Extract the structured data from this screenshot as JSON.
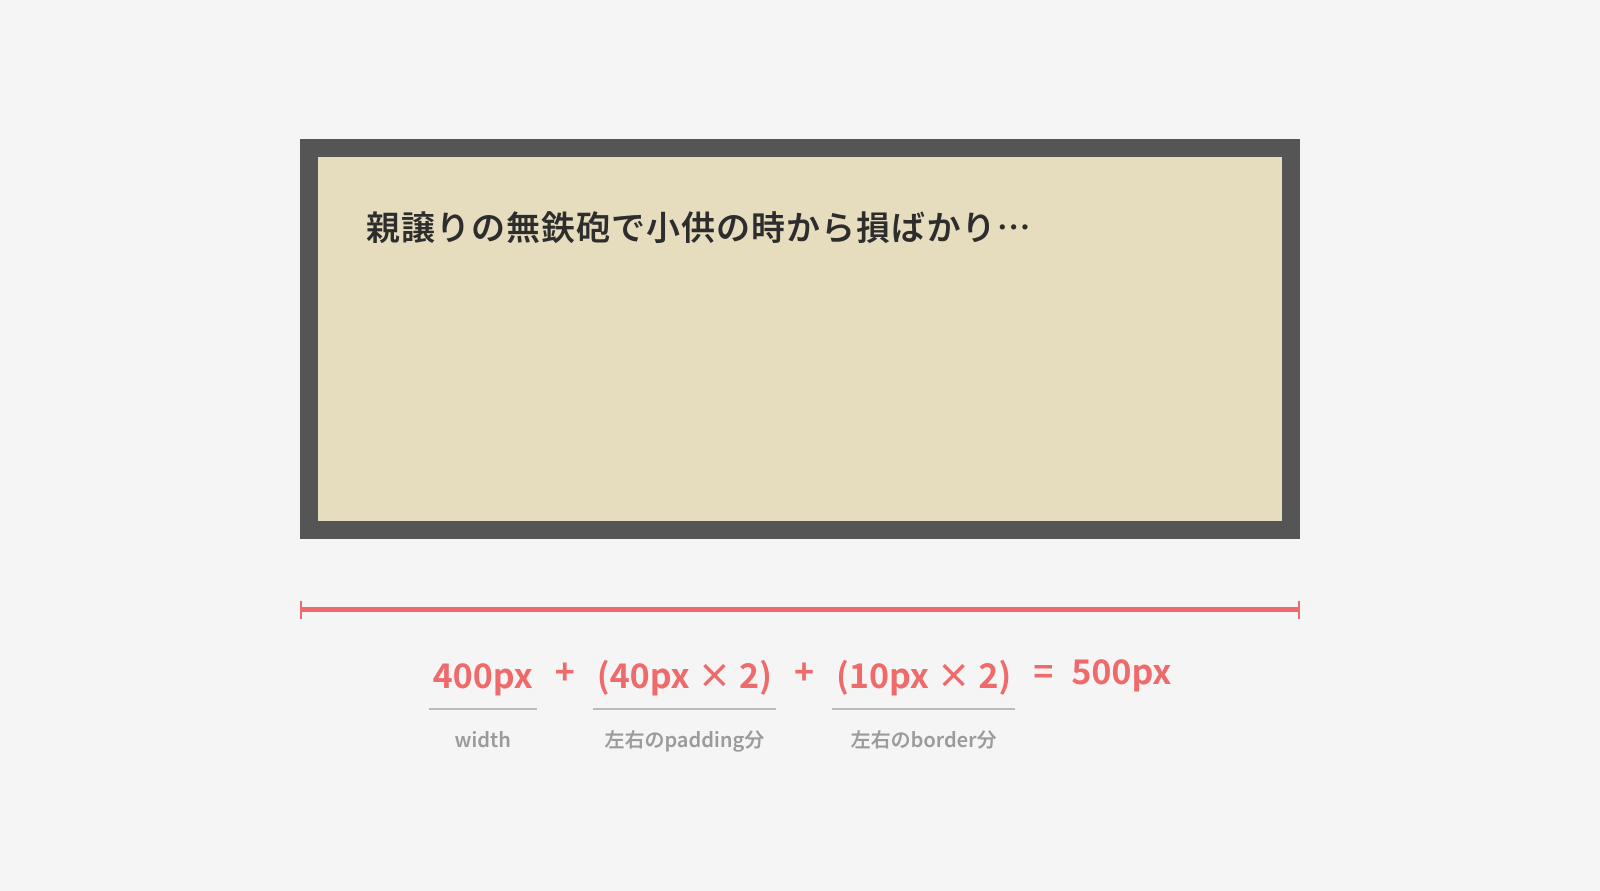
{
  "box": {
    "text": "親譲りの無鉄砲で小供の時から損ばかり…"
  },
  "equation": {
    "terms": [
      {
        "value": "400px",
        "label": "width"
      },
      {
        "value": "(40px × 2)",
        "label": "左右のpadding分"
      },
      {
        "value": "(10px × 2)",
        "label": "左右のborder分"
      }
    ],
    "op_plus": "+",
    "op_equals": "=",
    "result": "500px"
  }
}
